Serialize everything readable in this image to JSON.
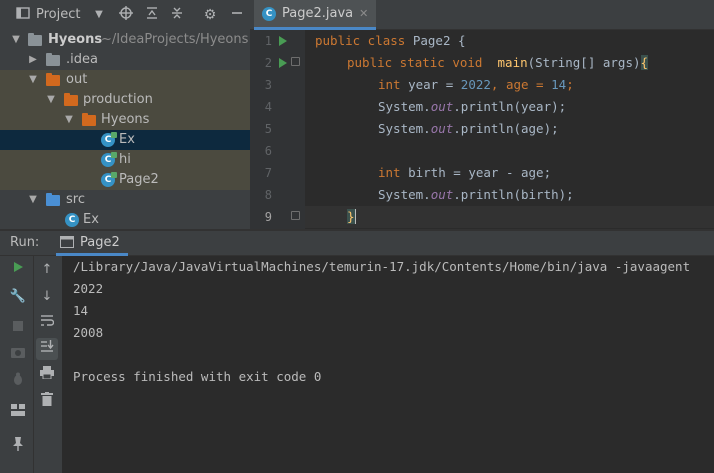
{
  "project_panel": {
    "title": "Project",
    "tree": [
      {
        "label": "Hyeons",
        "hint": "~/IdeaProjects/Hyeons"
      },
      {
        "label": ".idea"
      },
      {
        "label": "out"
      },
      {
        "label": "production"
      },
      {
        "label": "Hyeons"
      },
      {
        "label": "Ex"
      },
      {
        "label": "hi"
      },
      {
        "label": "Page2"
      },
      {
        "label": "src"
      },
      {
        "label": "Ex"
      }
    ]
  },
  "editor": {
    "tab_label": "Page2.java",
    "line_numbers": [
      "1",
      "2",
      "3",
      "4",
      "5",
      "6",
      "7",
      "8",
      "9"
    ],
    "lines": {
      "l1": {
        "a": "public class ",
        "b": "Page2 {"
      },
      "l2": {
        "a": "public static void  ",
        "b": "main",
        "c": "(String[] args)",
        "d": "{"
      },
      "l3": {
        "a": "int ",
        "b": "year = ",
        "c": "2022",
        "d": ", age = ",
        "e": "14",
        "f": ";"
      },
      "l4": {
        "a": "System.",
        "b": "out",
        "c": ".println(year);"
      },
      "l5": {
        "a": "System.",
        "b": "out",
        "c": ".println(age);"
      },
      "l7": {
        "a": "int ",
        "b": "birth = year - age;"
      },
      "l8": {
        "a": "System.",
        "b": "out",
        "c": ".println(birth);"
      },
      "l9": {
        "a": "}"
      }
    }
  },
  "run_window": {
    "title": "Run:",
    "tab_label": "Page2",
    "output": [
      "/Library/Java/JavaVirtualMachines/temurin-17.jdk/Contents/Home/bin/java -javaagent",
      "2022",
      "14",
      "2008",
      "",
      "Process finished with exit code 0"
    ]
  },
  "colors": {
    "keyword": "#cc7832",
    "number": "#6897bb",
    "method": "#ffc66d",
    "static_field": "#9876aa",
    "run_green": "#499c54",
    "selection": "#0d293e",
    "excluded_folder": "#4b4a3f"
  }
}
